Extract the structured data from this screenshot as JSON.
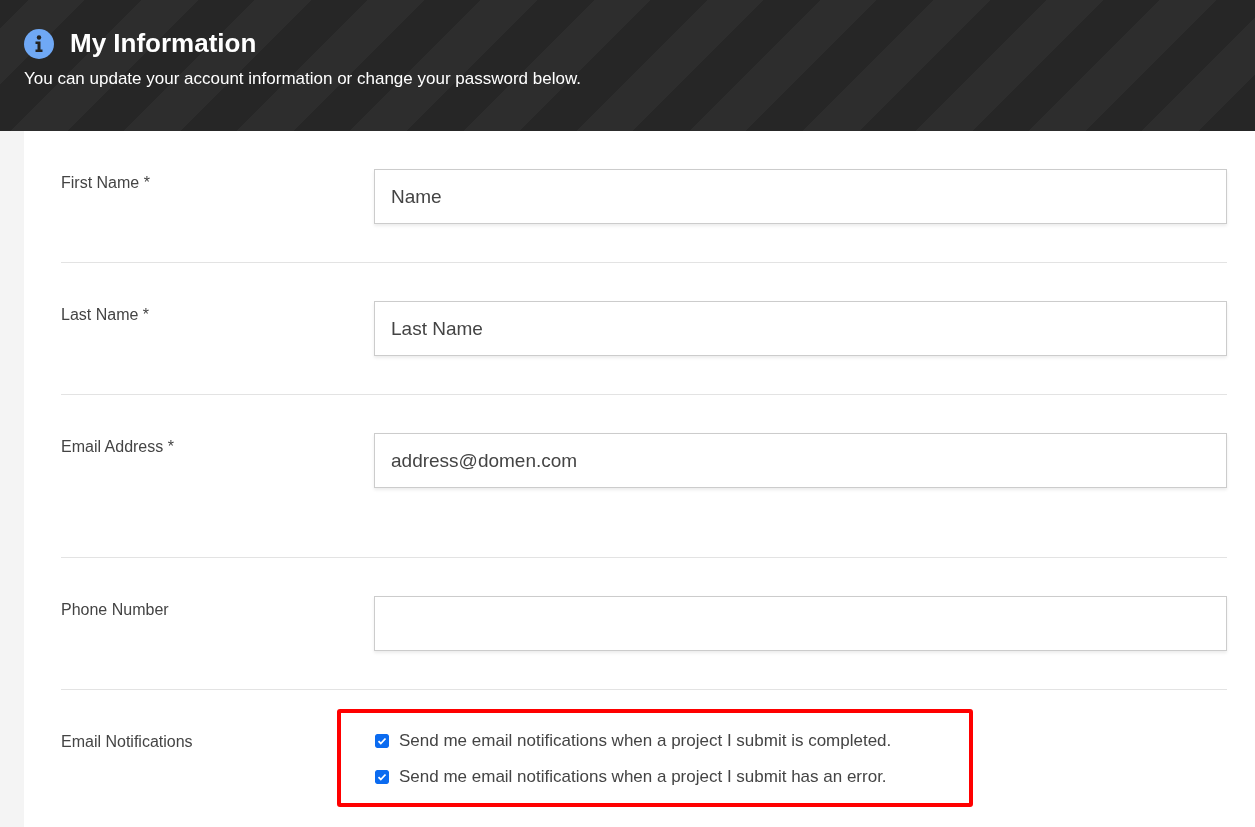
{
  "header": {
    "title": "My Information",
    "subtitle": "You can update your account information or change your password below."
  },
  "fields": [
    {
      "label": "First Name *",
      "value": "Name"
    },
    {
      "label": "Last Name *",
      "value": "Last Name"
    },
    {
      "label": "Email Address *",
      "value": "address@domen.com"
    },
    {
      "label": "Phone Number"
    }
  ],
  "notifications": {
    "label": "Email Notifications",
    "options": [
      {
        "text": "Send me email notifications when a project I submit is completed.",
        "checked": true
      },
      {
        "text": "Send me email notifications when a project I submit has an error.",
        "checked": true
      }
    ]
  }
}
